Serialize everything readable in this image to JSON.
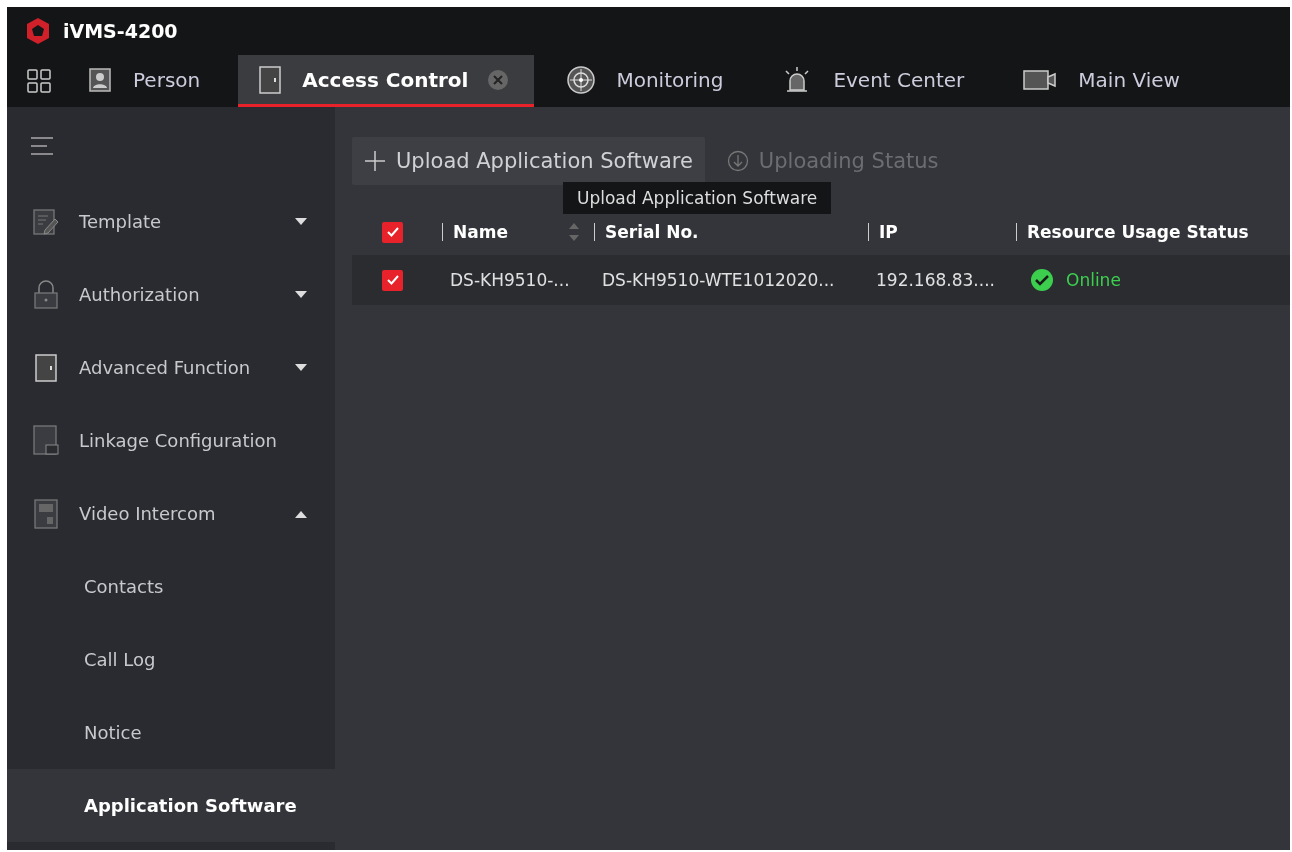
{
  "app": {
    "title": "iVMS-4200"
  },
  "tabs": [
    {
      "label": "Person",
      "selected": false,
      "closable": false
    },
    {
      "label": "Access Control",
      "selected": true,
      "closable": true
    },
    {
      "label": "Monitoring",
      "selected": false,
      "closable": false
    },
    {
      "label": "Event Center",
      "selected": false,
      "closable": false
    },
    {
      "label": "Main View",
      "selected": false,
      "closable": false
    }
  ],
  "sidebar": {
    "items": [
      {
        "label": "Template",
        "expanded": false,
        "selected": false
      },
      {
        "label": "Authorization",
        "expanded": false,
        "selected": false
      },
      {
        "label": "Advanced Function",
        "expanded": false,
        "selected": false
      },
      {
        "label": "Linkage Configuration",
        "selected": false
      },
      {
        "label": "Video Intercom",
        "expanded": true,
        "selected": false,
        "children": [
          {
            "label": "Contacts",
            "selected": false
          },
          {
            "label": "Call Log",
            "selected": false
          },
          {
            "label": "Notice",
            "selected": false
          },
          {
            "label": "Application Software",
            "selected": true
          }
        ]
      }
    ]
  },
  "toolbar": [
    {
      "label": "Upload Application Software",
      "disabled": false
    },
    {
      "label": "Uploading Status",
      "disabled": true
    }
  ],
  "tooltip": "Upload Application Software",
  "table": {
    "all_checked": true,
    "columns": [
      "Name",
      "Serial No.",
      "IP",
      "Resource Usage Status"
    ],
    "rows": [
      {
        "checked": true,
        "cells": [
          "DS-KH9510-...",
          "DS-KH9510-WTE1012020...",
          "192.168.83...."
        ],
        "status": "Online"
      }
    ]
  }
}
